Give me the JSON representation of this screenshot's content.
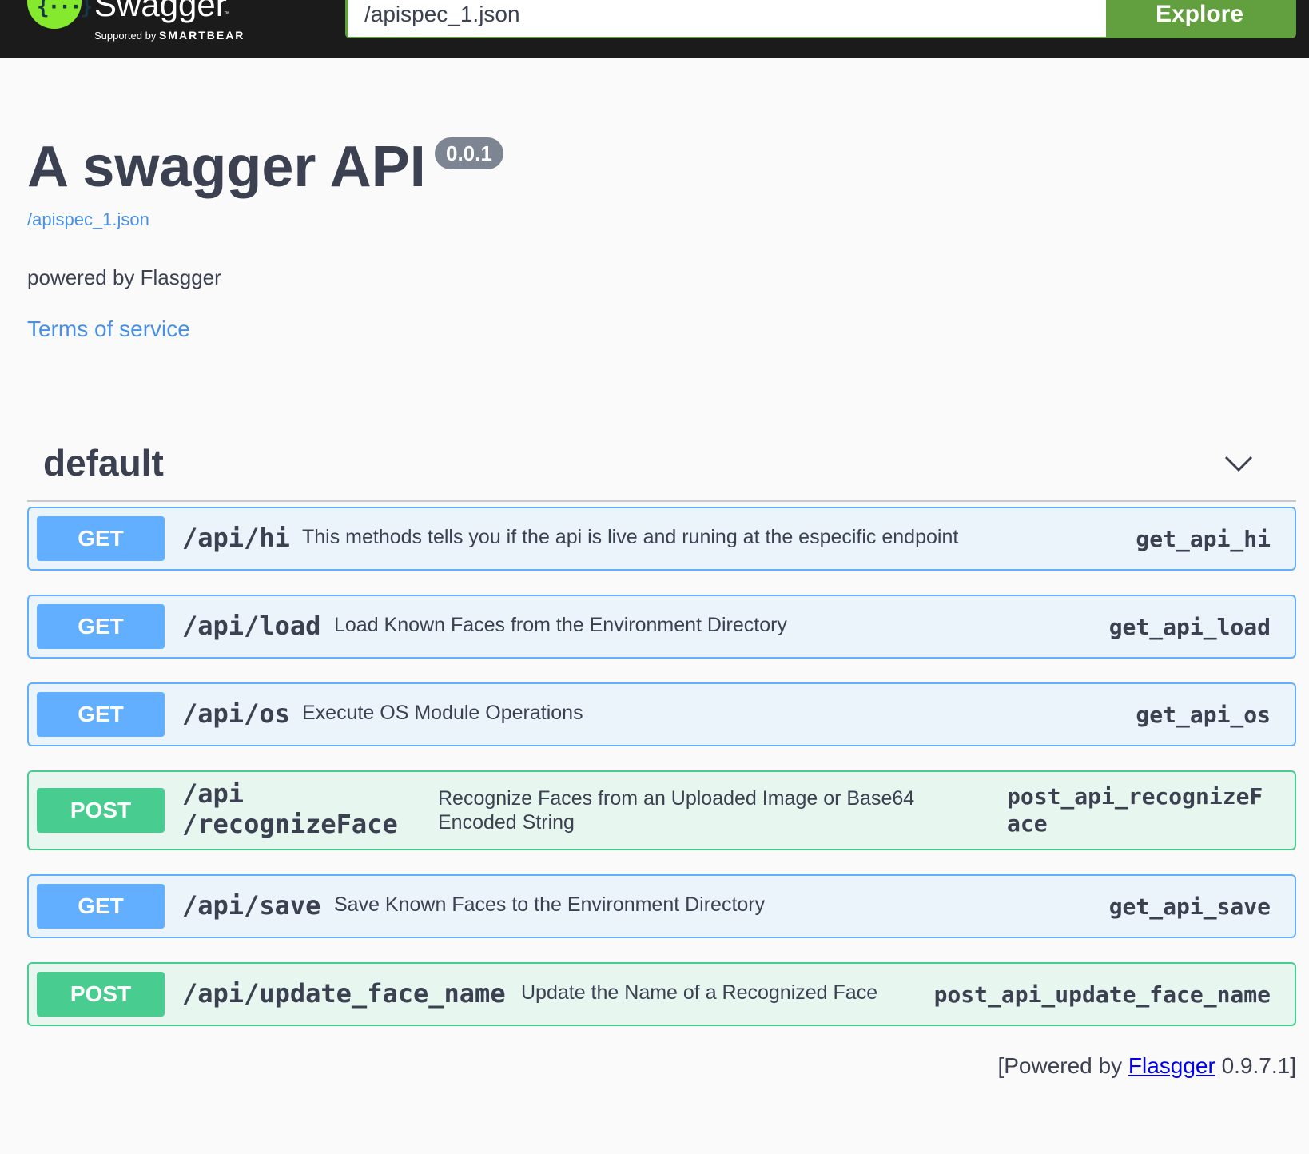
{
  "topbar": {
    "brand": "Swagger",
    "tm": "™",
    "supported_prefix": "Supported by",
    "supported_brand": "SMARTBEAR",
    "logo_glyph": "{···}",
    "url_value": "/apispec_1.json",
    "explore_label": "Explore"
  },
  "info": {
    "title": "A swagger API",
    "version": "0.0.1",
    "spec_link": "/apispec_1.json",
    "description": "powered by Flasgger",
    "terms_link": "Terms of service"
  },
  "tag": {
    "name": "default",
    "icon": "chevron-down-icon"
  },
  "operations": [
    {
      "method": "GET",
      "path": "/api/hi",
      "summary": "This methods tells you if the api is live and runing at the especific endpoint",
      "operation_id": "get_api_hi"
    },
    {
      "method": "GET",
      "path": "/api/load",
      "summary": "Load Known Faces from the Environment Directory",
      "operation_id": "get_api_load"
    },
    {
      "method": "GET",
      "path": "/api/os",
      "summary": "Execute OS Module Operations",
      "operation_id": "get_api_os"
    },
    {
      "method": "POST",
      "path": "/api /recognizeFace",
      "summary": "Recognize Faces from an Uploaded Image or Base64 Encoded String",
      "operation_id": "post_api_recognizeFace"
    },
    {
      "method": "GET",
      "path": "/api/save",
      "summary": "Save Known Faces to the Environment Directory",
      "operation_id": "get_api_save"
    },
    {
      "method": "POST",
      "path": "/api/update_face_name",
      "summary": "Update the Name of a Recognized Face",
      "operation_id": "post_api_update_face_name"
    }
  ],
  "footer": {
    "prefix": "[Powered by ",
    "link": "Flasgger",
    "suffix": " 0.9.7.1]"
  },
  "colors": {
    "get": "#61affe",
    "post": "#49cc90",
    "topbar": "#1b1b1b",
    "explore": "#62a03f",
    "logo": "#85ea2d"
  }
}
